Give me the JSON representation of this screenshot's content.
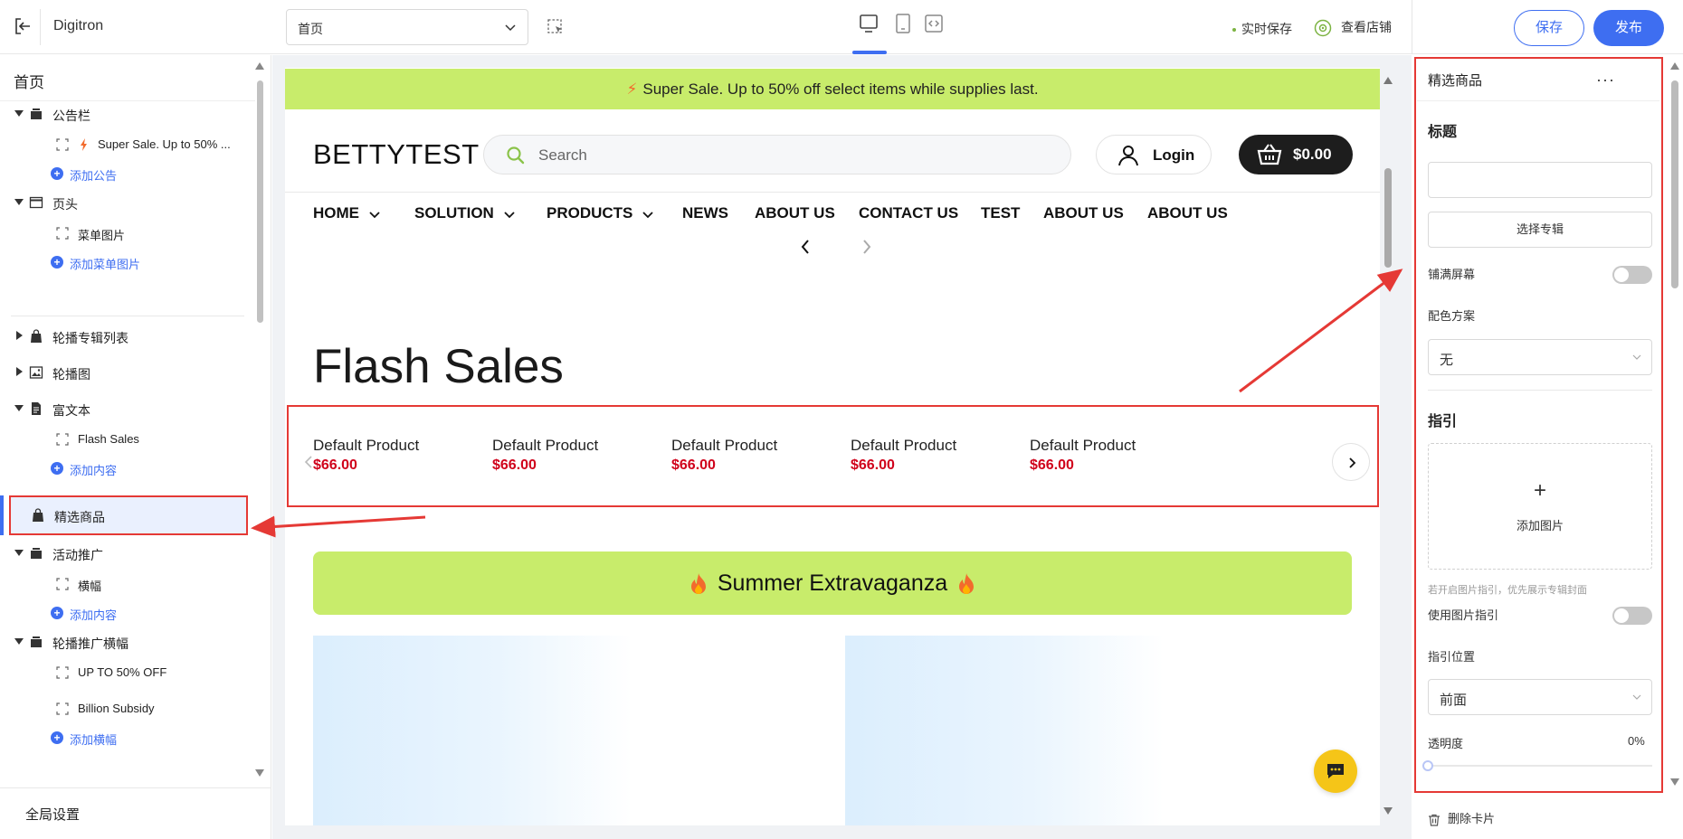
{
  "topbar": {
    "app_name": "Digitron",
    "page_select": "首页",
    "autosave": "实时保存",
    "view_store": "查看店铺",
    "save": "保存",
    "publish": "发布"
  },
  "left": {
    "home": "首页",
    "announcement": {
      "label": "公告栏",
      "child": "Super Sale. Up to 50% ...",
      "add": "添加公告"
    },
    "header": {
      "label": "页头",
      "child": "菜单图片",
      "add": "添加菜单图片"
    },
    "carousel_album_list": {
      "label": "轮播专辑列表"
    },
    "carousel": {
      "label": "轮播图"
    },
    "rich_text": {
      "label": "富文本",
      "child": "Flash Sales",
      "add": "添加内容"
    },
    "featured": {
      "label": "精选商品"
    },
    "promotion": {
      "label": "活动推广",
      "child": "横幅",
      "add": "添加内容"
    },
    "carousel_banner": {
      "label": "轮播推广横幅",
      "children": [
        "UP TO 50% OFF",
        "Billion Subsidy"
      ],
      "add": "添加横幅"
    },
    "global_settings": "全局设置"
  },
  "canvas": {
    "announcement": "Super Sale. Up to 50% off select items while supplies last.",
    "brand": "BETTYTEST",
    "search_placeholder": "Search",
    "login": "Login",
    "cart_total": "$0.00",
    "nav": [
      "HOME",
      "SOLUTION",
      "PRODUCTS",
      "NEWS",
      "ABOUT US",
      "CONTACT US",
      "TEST",
      "ABOUT US",
      "ABOUT US"
    ],
    "flash_title": "Flash Sales",
    "products": [
      {
        "name": "Default Product",
        "price": "$66.00"
      },
      {
        "name": "Default Product",
        "price": "$66.00"
      },
      {
        "name": "Default Product",
        "price": "$66.00"
      },
      {
        "name": "Default Product",
        "price": "$66.00"
      },
      {
        "name": "Default Product",
        "price": "$66.00"
      }
    ],
    "promo_title": "Summer Extravaganza"
  },
  "right": {
    "title": "精选商品",
    "more": "···",
    "heading_title": "标题",
    "select_album": "选择专辑",
    "full_screen": "铺满屏幕",
    "color_scheme": "配色方案",
    "color_scheme_value": "无",
    "heading_guide": "指引",
    "add_image": "添加图片",
    "add_image_plus": "+",
    "hint": "若开启图片指引，优先展示专辑封面",
    "use_image_guide": "使用图片指引",
    "guide_position": "指引位置",
    "guide_position_value": "前面",
    "opacity": "透明度",
    "opacity_value": "0%",
    "delete_card": "删除卡片"
  },
  "colors": {
    "accent": "#3e6ef1",
    "highlight_lime": "#c8ec6b",
    "annotation_red": "#e53935",
    "price_red": "#d0021b"
  }
}
